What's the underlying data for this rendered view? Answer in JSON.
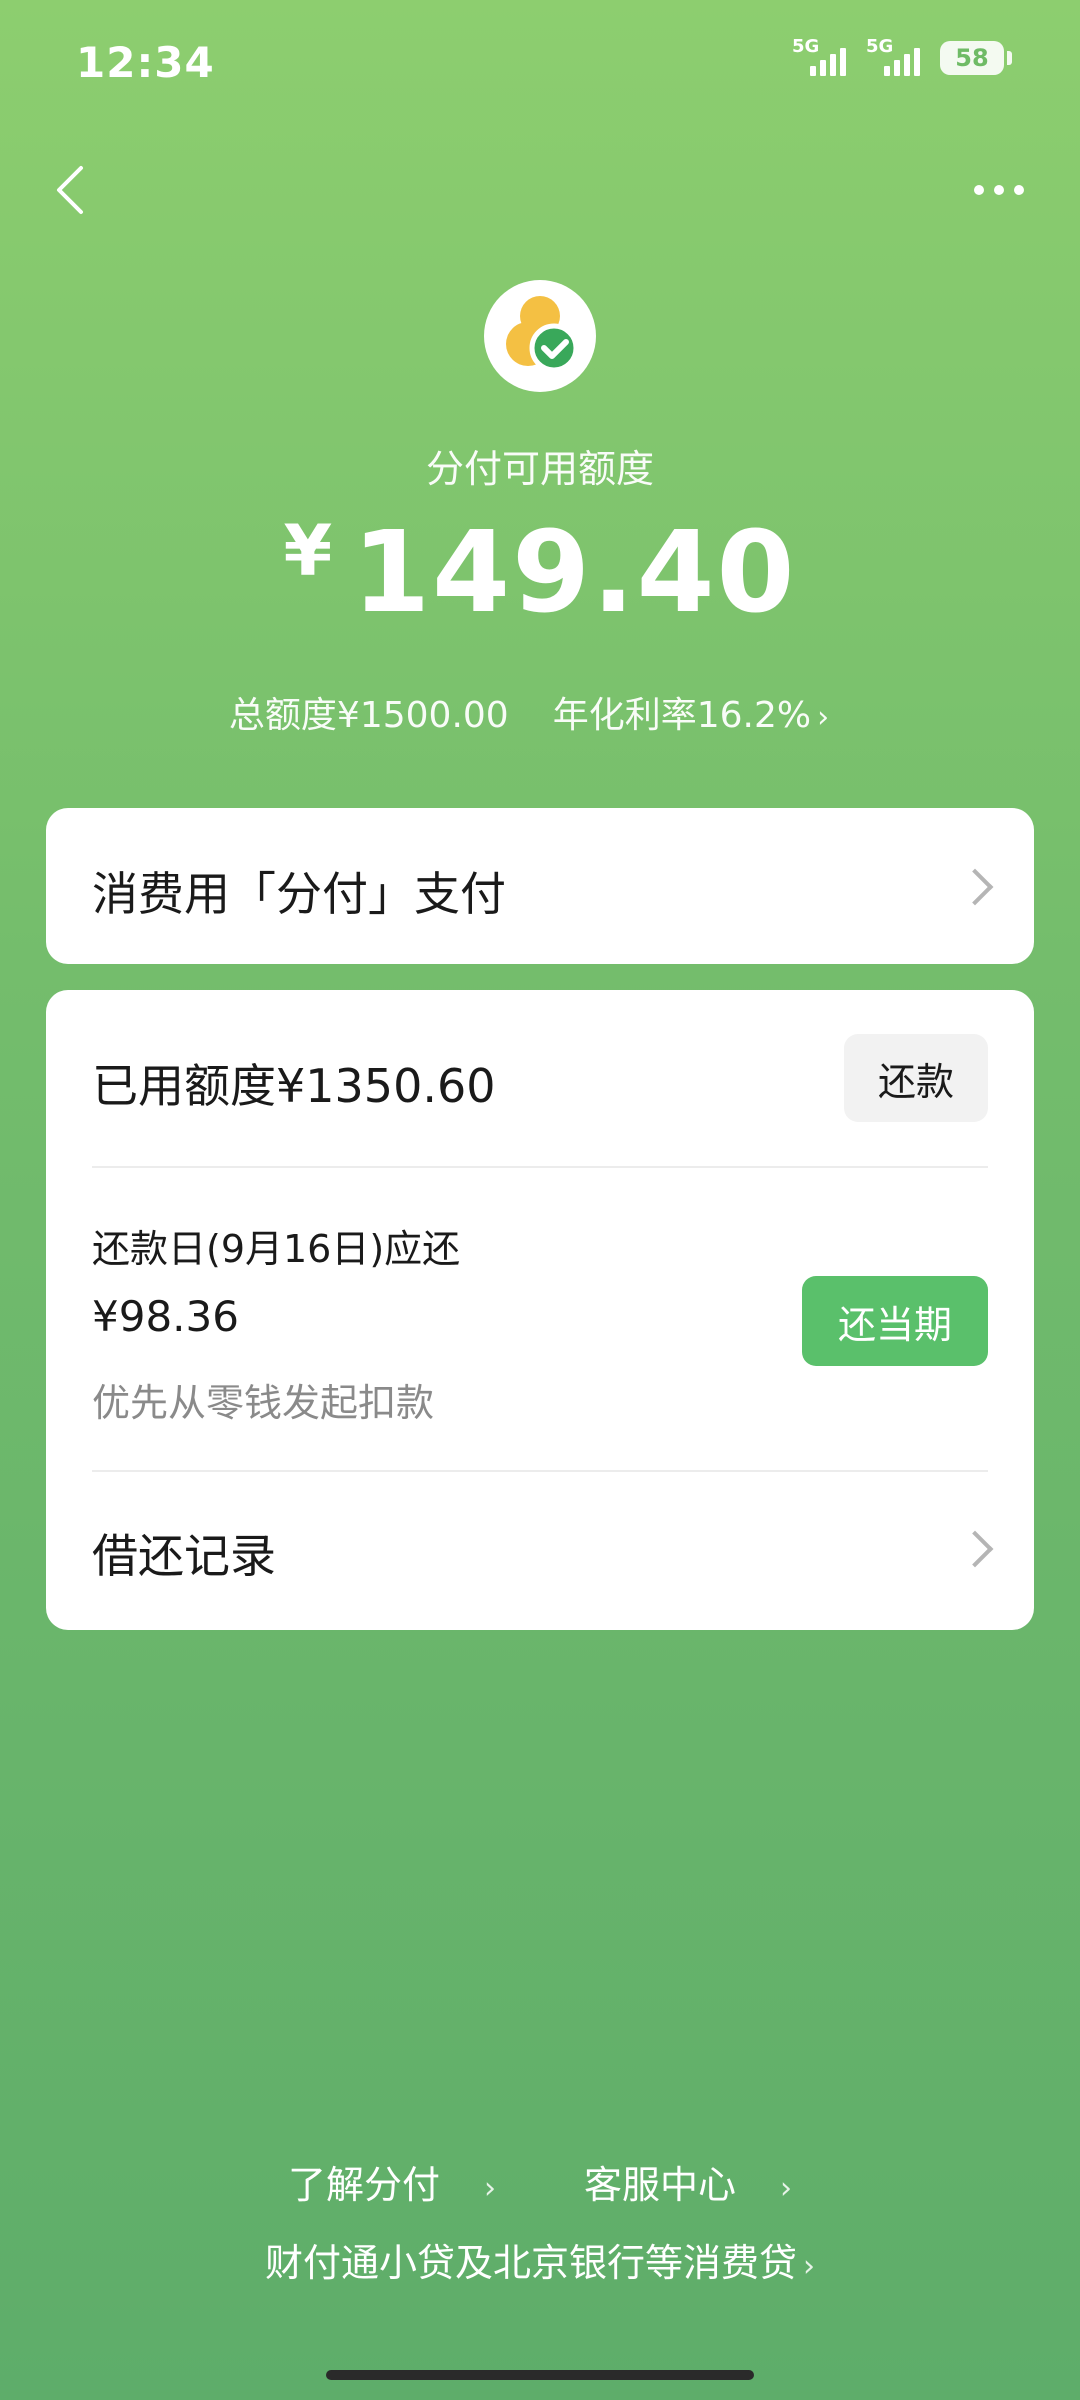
{
  "status": {
    "time": "12:34",
    "signal1_label": "5G",
    "signal2_label": "5G",
    "battery": "58"
  },
  "nav": {
    "back_icon": "chevron-left-icon",
    "more_icon": "more-dots-icon"
  },
  "header": {
    "available_label": "分付可用额度",
    "currency": "¥",
    "available_amount": "149.40",
    "total_limit": "总额度¥1500.00",
    "annual_rate": "年化利率16.2%"
  },
  "pay_card": {
    "label": "消费用「分付」支付"
  },
  "main_card": {
    "used_label": "已用额度¥1350.60",
    "repay_button": "还款",
    "due_label": "还款日(9月16日)应还",
    "due_amount": "¥98.36",
    "due_note": "优先从零钱发起扣款",
    "current_button": "还当期",
    "records_label": "借还记录"
  },
  "footer": {
    "learn": "了解分付",
    "service": "客服中心",
    "lender": "财付通小贷及北京银行等消费贷"
  },
  "colors": {
    "accent": "#5ac06b",
    "bg_top": "#8dce6f",
    "bg_bottom": "#5ead6a"
  }
}
